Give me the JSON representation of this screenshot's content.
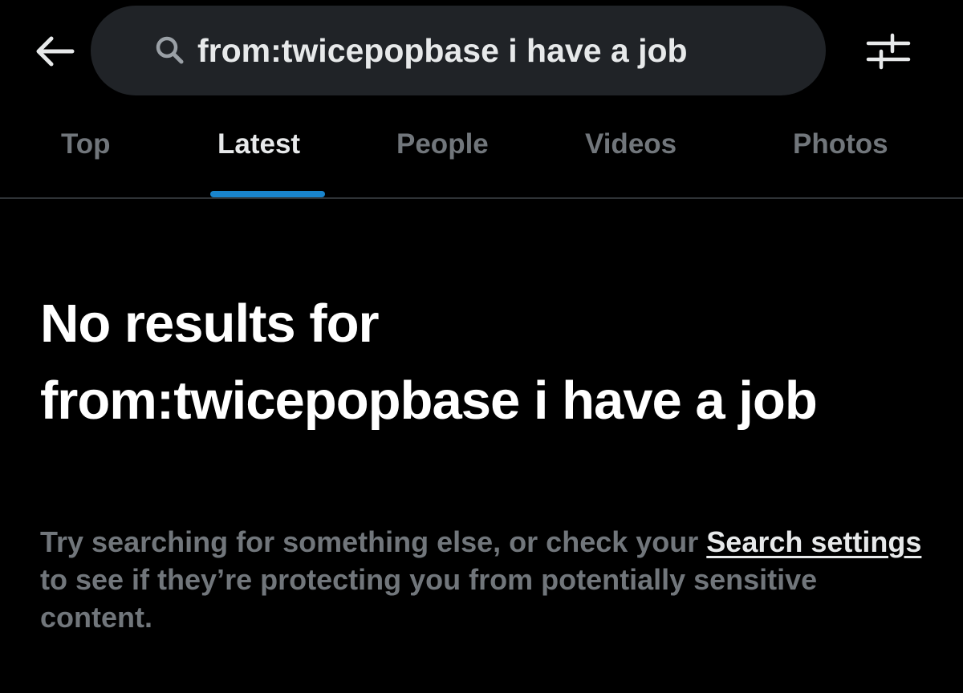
{
  "header": {
    "back_icon": "arrow-left-icon",
    "search_icon": "search-icon",
    "search_value": "from:twicepopbase i have a job",
    "filter_icon": "sliders-icon"
  },
  "tabs": [
    {
      "label": "Top",
      "active": false
    },
    {
      "label": "Latest",
      "active": true
    },
    {
      "label": "People",
      "active": false
    },
    {
      "label": "Videos",
      "active": false
    },
    {
      "label": "Photos",
      "active": false
    }
  ],
  "empty_state": {
    "title_prefix": "No results for",
    "query": "from:twicepopbase i have a job",
    "body_before_link": "Try searching for something else, or check your ",
    "link_text": "Search settings",
    "body_after_link": " to see if they’re protecting you from potentially sensitive content."
  },
  "colors": {
    "background": "#000000",
    "pill": "#202327",
    "primary_text": "#e7e9ea",
    "secondary_text": "#71767b",
    "accent": "#1d9bf0",
    "divider": "#2f3336"
  }
}
